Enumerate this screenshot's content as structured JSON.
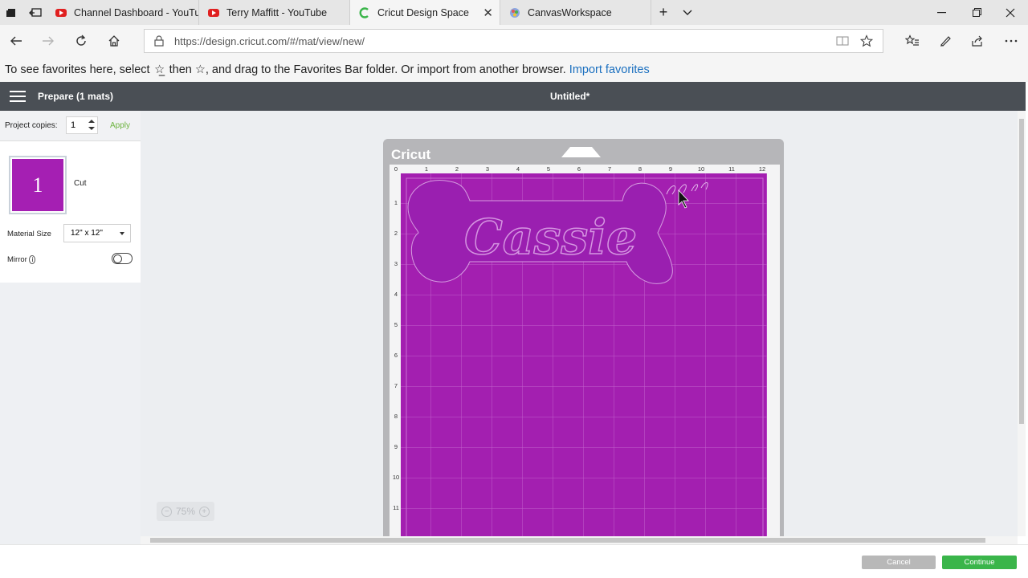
{
  "browser": {
    "tabs": [
      {
        "title": "Channel Dashboard - YouTu",
        "icon": "youtube-icon"
      },
      {
        "title": "Terry Maffitt - YouTube",
        "icon": "youtube-icon"
      },
      {
        "title": "Cricut Design Space",
        "icon": "cricut-icon",
        "active": true
      },
      {
        "title": "CanvasWorkspace",
        "icon": "canvasworkspace-icon"
      }
    ],
    "url": "https://design.cricut.com/#/mat/view/new/",
    "favorites_bar": {
      "text_before": "To see favorites here, select",
      "text_middle": "then ☆, and drag to the Favorites Bar folder. Or import from another browser.",
      "link": "Import favorites"
    }
  },
  "app": {
    "header_left": "Prepare (1 mats)",
    "title": "Untitled*",
    "project_copies_label": "Project copies:",
    "project_copies_value": "1",
    "apply_label": "Apply",
    "mat_number": "1",
    "mat_cut_label": "Cut",
    "material_size_label": "Material Size",
    "material_size_value": "12\" x 12\"",
    "mirror_label": "Mirror",
    "mirror_on": false,
    "zoom_level": "75%",
    "cancel_label": "Cancel",
    "continue_label": "Continue"
  },
  "mat": {
    "logo": "Cricut",
    "ruler_x": [
      "0",
      "1",
      "2",
      "3",
      "4",
      "5",
      "6",
      "7",
      "8",
      "9",
      "10",
      "11",
      "12"
    ],
    "ruler_y": [
      "1",
      "2",
      "3",
      "4",
      "5",
      "6",
      "7",
      "8",
      "9",
      "10",
      "11"
    ],
    "design_text": "Cassie",
    "color": "#a31fb0"
  }
}
